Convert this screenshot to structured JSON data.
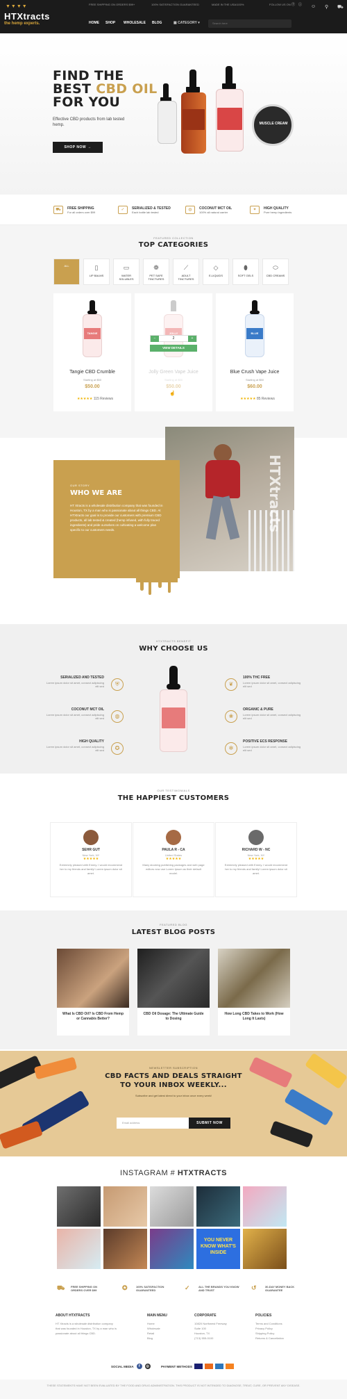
{
  "header": {
    "logo_name": "HTXtracts",
    "logo_tag": "the hemp experts.",
    "ticker": [
      "FREE SHIPPING ON ORDERS $99+",
      "100% SATISFACTION GUARANTEED",
      "MADE IN THE USA/100%"
    ],
    "follow": "FOLLOW US ON:",
    "nav": [
      "HOME",
      "SHOP",
      "WHOLESALE",
      "BLOG"
    ],
    "category_label": "CATEGORY",
    "search_placeholder": "Search here"
  },
  "hero": {
    "line1": "FIND THE",
    "line2a": "BEST ",
    "line2b": "CBD OIL",
    "line3": "FOR YOU",
    "subtitle": "Effective CBD products from lab tested hemp.",
    "cta": "SHOP NOW",
    "jar_label": "MUSCLE CREAM"
  },
  "features": [
    {
      "title": "FREE SHIPPING",
      "text": "For all orders over $99"
    },
    {
      "title": "SERIALIZED & TESTED",
      "text": "Each bottle lab tested"
    },
    {
      "title": "COCONUT MCT OIL",
      "text": "100% all natural carrier"
    },
    {
      "title": "HIGH QUALITY",
      "text": "Pure hemp ingredients"
    }
  ],
  "categories": {
    "eyebrow": "FEATURED COLLECTION",
    "title": "TOP CATEGORIES",
    "items": [
      "ALL",
      "LIP BALMS",
      "WATER SOLUBLES",
      "PET SAFE TINCTURES",
      "ADULT TINCTURES",
      "E-LIQUIDS",
      "SOFT GELS",
      "CBD CREAMS"
    ]
  },
  "products": [
    {
      "name": "Tangie CBD Crumble",
      "sub": "Starting at $50",
      "price": "$50.00",
      "reviews": "115 Reviews",
      "label": "TANGIE",
      "color": "#e77b7b"
    },
    {
      "name": "Jolly Green Vape Juice",
      "sub": "Starting at $50",
      "price": "$50.00",
      "reviews": "",
      "label": "JOLLY",
      "color": "#f3b7b7",
      "qty": "2",
      "action": "VIEW DETAILS"
    },
    {
      "name": "Blue Crush Vape Juice",
      "sub": "Starting at $50",
      "price": "$60.00",
      "reviews": "85 Reviews",
      "label": "BLUE",
      "color": "#3a7bc8"
    }
  ],
  "about": {
    "eyebrow": "OUR STORY",
    "title": "WHO WE ARE",
    "text": "HT Xtracts is a wholesale distribution company that was founded in Houston, TX by a man who is passionate about all things CBD. At HTXtracts our goal is to provide our customers with premium CBD products, all lab tested & created (hemp infused, with fully traced ingredients) and pride ourselves on cultivating a welcome plan specific to our customers needs.",
    "side_text": "HTXtracts"
  },
  "why": {
    "eyebrow": "HTXTRACTS BENEFIT",
    "title": "WHY CHOOSE US",
    "left": [
      {
        "t": "SERIALIZED AND TESTED",
        "d": "Lorem ipsum dolor sit amet, consect adipiscing elit sed"
      },
      {
        "t": "COCONUT MCT OIL",
        "d": "Lorem ipsum dolor sit amet, consect adipiscing elit sed"
      },
      {
        "t": "HIGH QUALITY",
        "d": "Lorem ipsum dolor sit amet, consect adipiscing elit sed"
      }
    ],
    "right": [
      {
        "t": "100% THC FREE",
        "d": "Lorem ipsum dolor sit amet, consect adipiscing elit sed"
      },
      {
        "t": "ORGANIC & PURE",
        "d": "Lorem ipsum dolor sit amet, consect adipiscing elit sed"
      },
      {
        "t": "POSITIVE ECS RESPONSE",
        "d": "Lorem ipsum dolor sit amet, consect adipiscing elit sed"
      }
    ]
  },
  "testimonials": {
    "eyebrow": "OUR TESTIMONIALS",
    "title": "THE HAPPIEST CUSTOMERS",
    "items": [
      {
        "name": "SEHR GUT",
        "loc": "New York, NY",
        "text": "Extremely pleased with Emmy. I would recommend her to my friends and family! Lorem ipsum dolor sit amet."
      },
      {
        "name": "PAULA R - CA",
        "loc": "United States",
        "text": "Many stocking publishing packages and web page editors now use Lorem Ipsum as their default model."
      },
      {
        "name": "RICHARD W - NC",
        "loc": "New York, NY",
        "text": "Extremely pleased with Emmy. I would recommend her to my friends and family! Lorem ipsum dolor sit amet."
      }
    ]
  },
  "blog": {
    "eyebrow": "FEATURED BLOG",
    "title": "LATEST BLOG POSTS",
    "posts": [
      "What Is CBD Oil? Is CBD From Hemp or Cannabis Better?",
      "CBD Oil Dosage: The Ultimate Guide to Dosing",
      "How Long CBD Takes to Work (How Long It Lasts)"
    ]
  },
  "newsletter": {
    "eyebrow": "NEWSLETTER SUBSCRIPTION",
    "title1": "CBD FACTS AND DEALS STRAIGHT",
    "title2": "TO YOUR INBOX WEEKLY...",
    "sub": "Subscribe and get latest direct to your inbox once every week!",
    "placeholder": "Email address",
    "button": "SUBMIT NOW"
  },
  "instagram": {
    "title_a": "INSTAGRAM # ",
    "title_b": "HTXTRACTS",
    "tile_text": "YOU NEVER KNOW WHAT'S INSIDE"
  },
  "bottom_features": [
    "FREE SHIPPING ON ORDERS OVER $99",
    "100% SATISFACTION GUARANTEED",
    "ALL THE BRANDS YOU KNOW AND TRUST",
    "30-DAY MONEY BACK GUARANTEE"
  ],
  "footer": {
    "about_title": "ABOUT HTXTRACTS",
    "about_text": "HT Xtracts is a wholesale distribution company that was founded in Houston, TX by a man who is passionate about all things CBD.",
    "menu_title": "MAIN MENU",
    "menu": [
      "Home",
      "Wholesale",
      "Retail",
      "Blog"
    ],
    "corp_title": "CORPORATE",
    "corp": [
      "10820 Northwest Freeway",
      "Suite 100",
      "Houston, TX",
      "(713) 555-0100"
    ],
    "pol_title": "POLICIES",
    "pol": [
      "Terms and Conditions",
      "Privacy Policy",
      "Shipping Policy",
      "Returns & Cancellation"
    ],
    "social_label": "SOCIAL MEDIA",
    "payment_label": "PAYMENT METHODS",
    "copyright": "THESE STATEMENTS HAVE NOT BEEN EVALUATED BY THE FOOD AND DRUG ADMINISTRATION. THIS PRODUCT IS NOT INTENDED TO DIAGNOSE, TREAT, CURE, OR PREVENT ANY DISEASE."
  }
}
